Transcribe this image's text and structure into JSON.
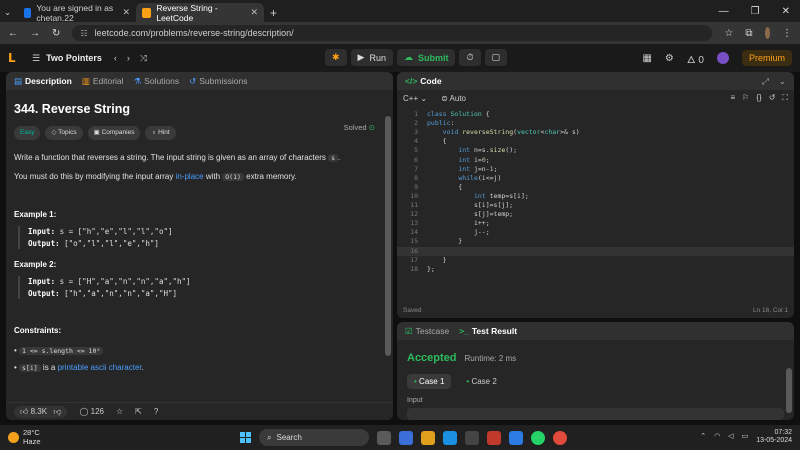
{
  "browser": {
    "tabs": [
      {
        "title": "You are signed in as chetan.22",
        "active": false
      },
      {
        "title": "Reverse String - LeetCode",
        "active": true
      }
    ],
    "new_tab": "+",
    "url": "leetcode.com/problems/reverse-string/description/"
  },
  "lc_header": {
    "problem_list": "Two Pointers",
    "run_label": "Run",
    "submit_label": "Submit",
    "streak": "0",
    "premium_label": "Premium"
  },
  "left_tabs": [
    "Description",
    "Editorial",
    "Solutions",
    "Submissions"
  ],
  "problem": {
    "title": "344. Reverse String",
    "status": "Solved",
    "tags": [
      "Easy",
      "Topics",
      "Companies",
      "Hint"
    ],
    "desc1_a": "Write a function that reverses a string. The input string is given as an array of characters ",
    "desc1_code": "s",
    "desc1_b": ".",
    "desc2_a": "You must do this by modifying the input array ",
    "desc2_link": "in-place",
    "desc2_b": " with ",
    "desc2_code": "O(1)",
    "desc2_c": " extra memory.",
    "examples": [
      {
        "title": "Example 1:",
        "input_label": "Input:",
        "input": "s = [\"h\",\"e\",\"l\",\"l\",\"o\"]",
        "output_label": "Output:",
        "output": "[\"o\",\"l\",\"l\",\"e\",\"h\"]"
      },
      {
        "title": "Example 2:",
        "input_label": "Input:",
        "input": "s = [\"H\",\"a\",\"n\",\"n\",\"a\",\"h\"]",
        "output_label": "Output:",
        "output": "[\"h\",\"a\",\"n\",\"n\",\"a\",\"H\"]"
      }
    ],
    "constraints_title": "Constraints:",
    "constraint1": "1 <= s.length <= 10⁵",
    "constraint2_code": "s[i]",
    "constraint2_a": " is a ",
    "constraint2_link": "printable ascii character",
    "constraint2_b": "."
  },
  "desc_footer": {
    "likes": "8.3K",
    "comments": "126"
  },
  "code_panel": {
    "title": "Code",
    "language": "C++",
    "mode": "Auto",
    "status": "Saved",
    "cursor": "Ln 16, Col 1",
    "lines": [
      "class Solution {",
      "public:",
      "    void reverseString(vector<char>& s)",
      "    {",
      "        int n=s.size();",
      "        int i=0;",
      "        int j=n-1;",
      "        while(i<=j)",
      "        {",
      "            int temp=s[i];",
      "            s[i]=s[j];",
      "            s[j]=temp;",
      "            i++;",
      "            j--;",
      "        }",
      "",
      "    }",
      "};"
    ]
  },
  "result_panel": {
    "tab_testcase": "Testcase",
    "tab_result": "Test Result",
    "verdict": "Accepted",
    "runtime": "Runtime: 2 ms",
    "cases": [
      "Case 1",
      "Case 2"
    ],
    "input_label": "Input"
  },
  "taskbar": {
    "temp": "28°C",
    "weather": "Haze",
    "search": "Search",
    "time": "07:32",
    "date": "13-05-2024"
  }
}
